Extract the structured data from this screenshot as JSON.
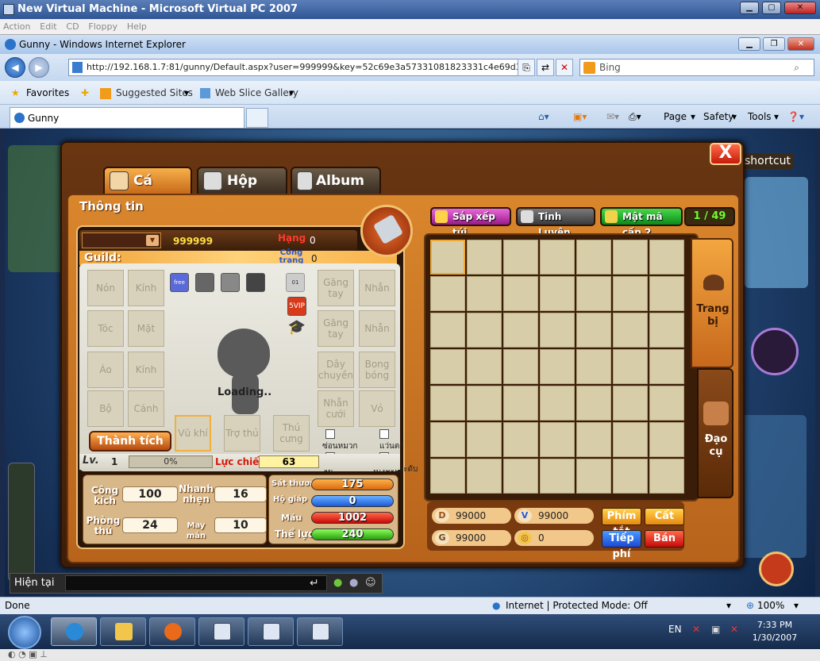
{
  "vpc": {
    "title": "New Virtual Machine - Microsoft Virtual PC 2007",
    "menu": [
      "Action",
      "Edit",
      "CD",
      "Floppy",
      "Help"
    ]
  },
  "ie": {
    "title": "Gunny - Windows Internet Explorer",
    "address": "http://192.168.1.7:81/gunny/Default.aspx?user=999999&key=52c69e3a57331081823331c4e69d3f2e",
    "search_placeholder": "Bing",
    "favorites": "Favorites",
    "suggested": "Suggested Sites",
    "webslice": "Web Slice Gallery",
    "tab": "Gunny",
    "cmd": {
      "page": "Page",
      "safety": "Safety",
      "tools": "Tools"
    }
  },
  "game": {
    "close": "X",
    "tabs": [
      "Cá nhân",
      "Hộp quà",
      "Album thẻ"
    ],
    "info_title": "Thông tin",
    "name_value": "999999",
    "hang_label": "Hạng",
    "hang_value": "0",
    "guild_label": "Guild:",
    "cong_trang_label": "Công trạng",
    "cong_trang_value": "0",
    "slots_left": [
      "Nón",
      "Kính",
      "Tóc",
      "Mặt",
      "Áo",
      "Kính",
      "Bộ",
      "Cánh"
    ],
    "slots_right": [
      "Găng tay",
      "Nhẫn",
      "Găng tay",
      "Nhẫn",
      "Dây chuyền",
      "Bong bóng",
      "Nhẫn cưới",
      "Vỏ"
    ],
    "slots_bottom": [
      "Vũ khí",
      "Trợ thủ",
      "Thú cưng"
    ],
    "loading": "Loading..",
    "thanh_tich": "Thành tích",
    "lv_label": "Lv.",
    "level": "1",
    "exp": "0%",
    "exp_fill": 0,
    "luc_chien_label": "Lực chiến",
    "luc_chien": "63",
    "checkboxes": [
      "ซ่อนหมวก",
      "แว่นตา",
      "ชุด",
      "เครื่องประดับ"
    ],
    "stats": {
      "cong_kich_label": "Công kích",
      "cong_kich": "100",
      "nhanh_nhen_label": "Nhanh nhẹn",
      "nhanh_nhen": "16",
      "phong_thu_label": "Phòng thủ",
      "phong_thu": "24",
      "may_man_label": "May mắn",
      "may_man": "10"
    },
    "bars": {
      "sat_thuong_label": "Sát thương",
      "sat_thuong": "175",
      "ho_giap_label": "Hộ giáp",
      "ho_giap": "0",
      "mau_label": "Máu",
      "mau": "1002",
      "the_luc_label": "Thể lực",
      "the_luc": "240"
    },
    "sort_btn": "Sắp xếp túi",
    "tinh_luyen_btn": "Tinh Luyện",
    "mat_ma_btn": "Mật mã cấp 2",
    "page_count": "1 / 49",
    "side_tab1": "Trang bị",
    "side_tab2": "Đạo cụ",
    "money": {
      "coin": "99000",
      "v": "99000",
      "g": "99000",
      "medal": "0"
    },
    "actions": {
      "phim_tat": "Phím tắt",
      "cat": "Cất",
      "tiep_phi": "Tiếp phí",
      "ban": "Bán"
    },
    "chat_label": "Hiện tại",
    "shortcut": "shortcut"
  },
  "status": {
    "left": "Done",
    "zone": "Internet | Protected Mode: Off",
    "zoom": "100%"
  },
  "taskbar": {
    "lang": "EN",
    "time": "7:33 PM",
    "date": "1/30/2007"
  }
}
